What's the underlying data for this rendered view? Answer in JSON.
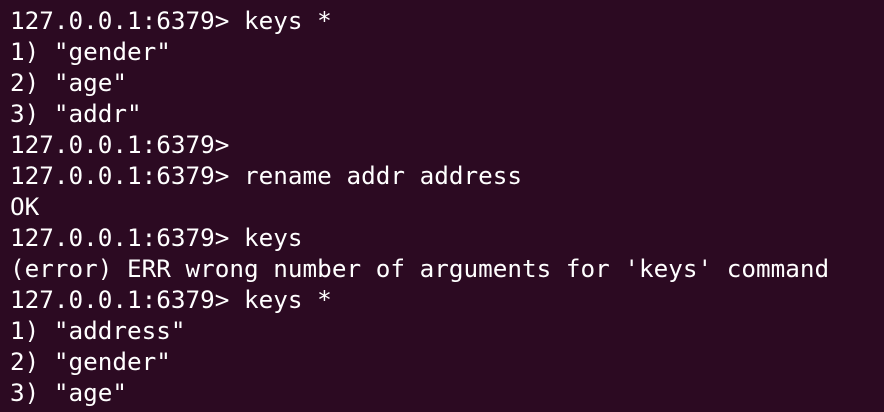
{
  "theme": {
    "background": "#2c0a22",
    "foreground": "#ffffff"
  },
  "lines": [
    "127.0.0.1:6379> keys *",
    "1) \"gender\"",
    "2) \"age\"",
    "3) \"addr\"",
    "127.0.0.1:6379>",
    "127.0.0.1:6379> rename addr address",
    "OK",
    "127.0.0.1:6379> keys",
    "(error) ERR wrong number of arguments for 'keys' command",
    "127.0.0.1:6379> keys *",
    "1) \"address\"",
    "2) \"gender\"",
    "3) \"age\""
  ]
}
